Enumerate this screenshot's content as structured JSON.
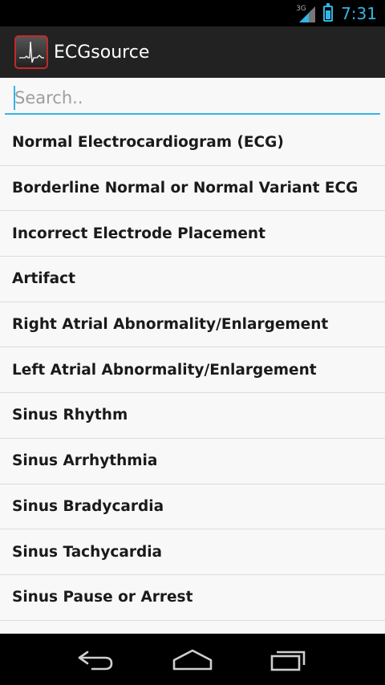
{
  "status_bar": {
    "network_label": "3G",
    "time": "7:31",
    "accent_color": "#33b5e5"
  },
  "app_bar": {
    "icon": "ecg-app-icon",
    "title": "ECGsource"
  },
  "search": {
    "placeholder": "Search..",
    "value": ""
  },
  "list": {
    "items": [
      "Normal Electrocardiogram (ECG)",
      "Borderline Normal or Normal Variant ECG",
      "Incorrect Electrode Placement",
      "Artifact",
      "Right Atrial Abnormality/Enlargement",
      "Left Atrial Abnormality/Enlargement",
      "Sinus Rhythm",
      "Sinus Arrhythmia",
      "Sinus Bradycardia",
      "Sinus Tachycardia",
      "Sinus Pause or Arrest"
    ]
  },
  "nav_bar": {
    "back_icon": "back-arrow-icon",
    "home_icon": "home-icon",
    "recents_icon": "recent-apps-icon"
  }
}
